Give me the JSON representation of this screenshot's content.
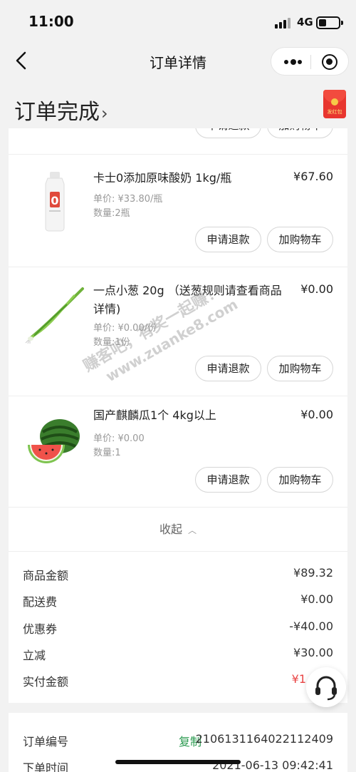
{
  "status_bar": {
    "time": "11:00",
    "network": "4G"
  },
  "navbar": {
    "title": "订单详情"
  },
  "order": {
    "status": "订单完成",
    "chevron": "›",
    "redpacket_label": "发红包"
  },
  "items": [
    {
      "name": "卡士0添加原味酸奶 1kg/瓶",
      "price": "¥67.60",
      "unit_price": "单价: ¥33.80/瓶",
      "quantity": "数量:2瓶",
      "image": "yogurt-bottle",
      "refund_label": "申请退款",
      "cart_label": "加购物车"
    },
    {
      "name": "一点小葱 20g （送葱规则请查看商品详情)",
      "price": "¥0.00",
      "unit_price": "单价: ¥0.00/份",
      "quantity": "数量:1份",
      "image": "green-onion",
      "refund_label": "申请退款",
      "cart_label": "加购物车"
    },
    {
      "name": "国产麒麟瓜1个 4kg以上",
      "price": "¥0.00",
      "unit_price": "单价: ¥0.00",
      "quantity": "数量:1",
      "image": "watermelon",
      "refund_label": "申请退款",
      "cart_label": "加购物车"
    }
  ],
  "collapse": {
    "label": "收起",
    "icon": "chevron-up-icon"
  },
  "summary": [
    {
      "label": "商品金额",
      "value": "¥89.32"
    },
    {
      "label": "配送费",
      "value": "¥0.00"
    },
    {
      "label": "优惠券",
      "value": "-¥40.00"
    },
    {
      "label": "立减",
      "value": "¥30.00"
    },
    {
      "label": "实付金额",
      "value": "¥1"
    }
  ],
  "order_info": [
    {
      "label": "订单编号",
      "action": "复制",
      "value": "2106131164022112409"
    },
    {
      "label": "下单时间",
      "value": "2021-06-13 09:42:41"
    }
  ],
  "watermark": {
    "line1": "赚客吧，有奖一起赚！",
    "line2": "www.zuanke8.com"
  },
  "colors": {
    "accent_green": "#2b9a50",
    "price_red": "#e94444",
    "redpacket": "#e8362f"
  }
}
